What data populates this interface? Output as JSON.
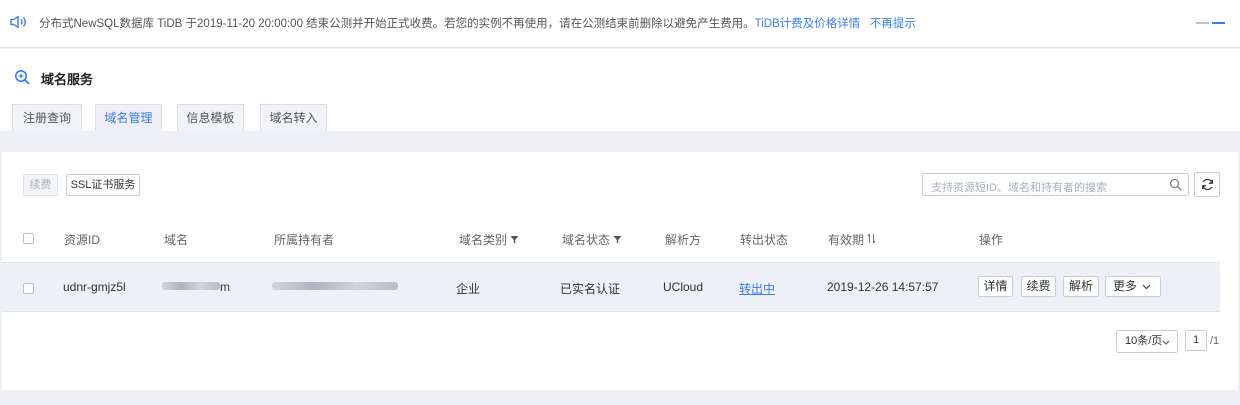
{
  "notice": {
    "message": "分布式NewSQL数据库 TiDB 于2019-11-20 20:00:00 结束公测并开始正式收费。若您的实例不再使用，请在公测结束前删除以避免产生费用。",
    "pricing_link": "TiDB计费及价格详情",
    "dismiss_link": "不再提示"
  },
  "header": {
    "title": "域名服务"
  },
  "tabs": [
    {
      "label": "注册查询"
    },
    {
      "label": "域名管理"
    },
    {
      "label": "信息模板"
    },
    {
      "label": "域名转入"
    }
  ],
  "toolbar": {
    "renew_label": "续费",
    "ssl_label": "SSL证书服务",
    "search_placeholder": "支持资源短ID、域名和持有者的搜索"
  },
  "table": {
    "headers": {
      "id": "资源ID",
      "domain": "域名",
      "owner": "所属持有者",
      "type": "域名类别",
      "status": "域名状态",
      "resolver": "解析方",
      "transfer": "转出状态",
      "expiry": "有效期",
      "actions": "操作"
    },
    "rows": [
      {
        "id": "udnr-gmjz5l",
        "domain_suffix": "m",
        "type": "企业",
        "status": "已实名认证",
        "resolver": "UCloud",
        "transfer": "转出中",
        "expiry": "2019-12-26 14:57:57",
        "actions": {
          "detail": "详情",
          "renew": "续费",
          "resolve": "解析",
          "more": "更多"
        }
      }
    ]
  },
  "pagination": {
    "page_size": "10条/页",
    "page": "1",
    "total": "/1"
  },
  "colors": {
    "accent": "#3a7df0",
    "row_bg": "#edf0f6",
    "page_bg": "#eef0f5"
  }
}
